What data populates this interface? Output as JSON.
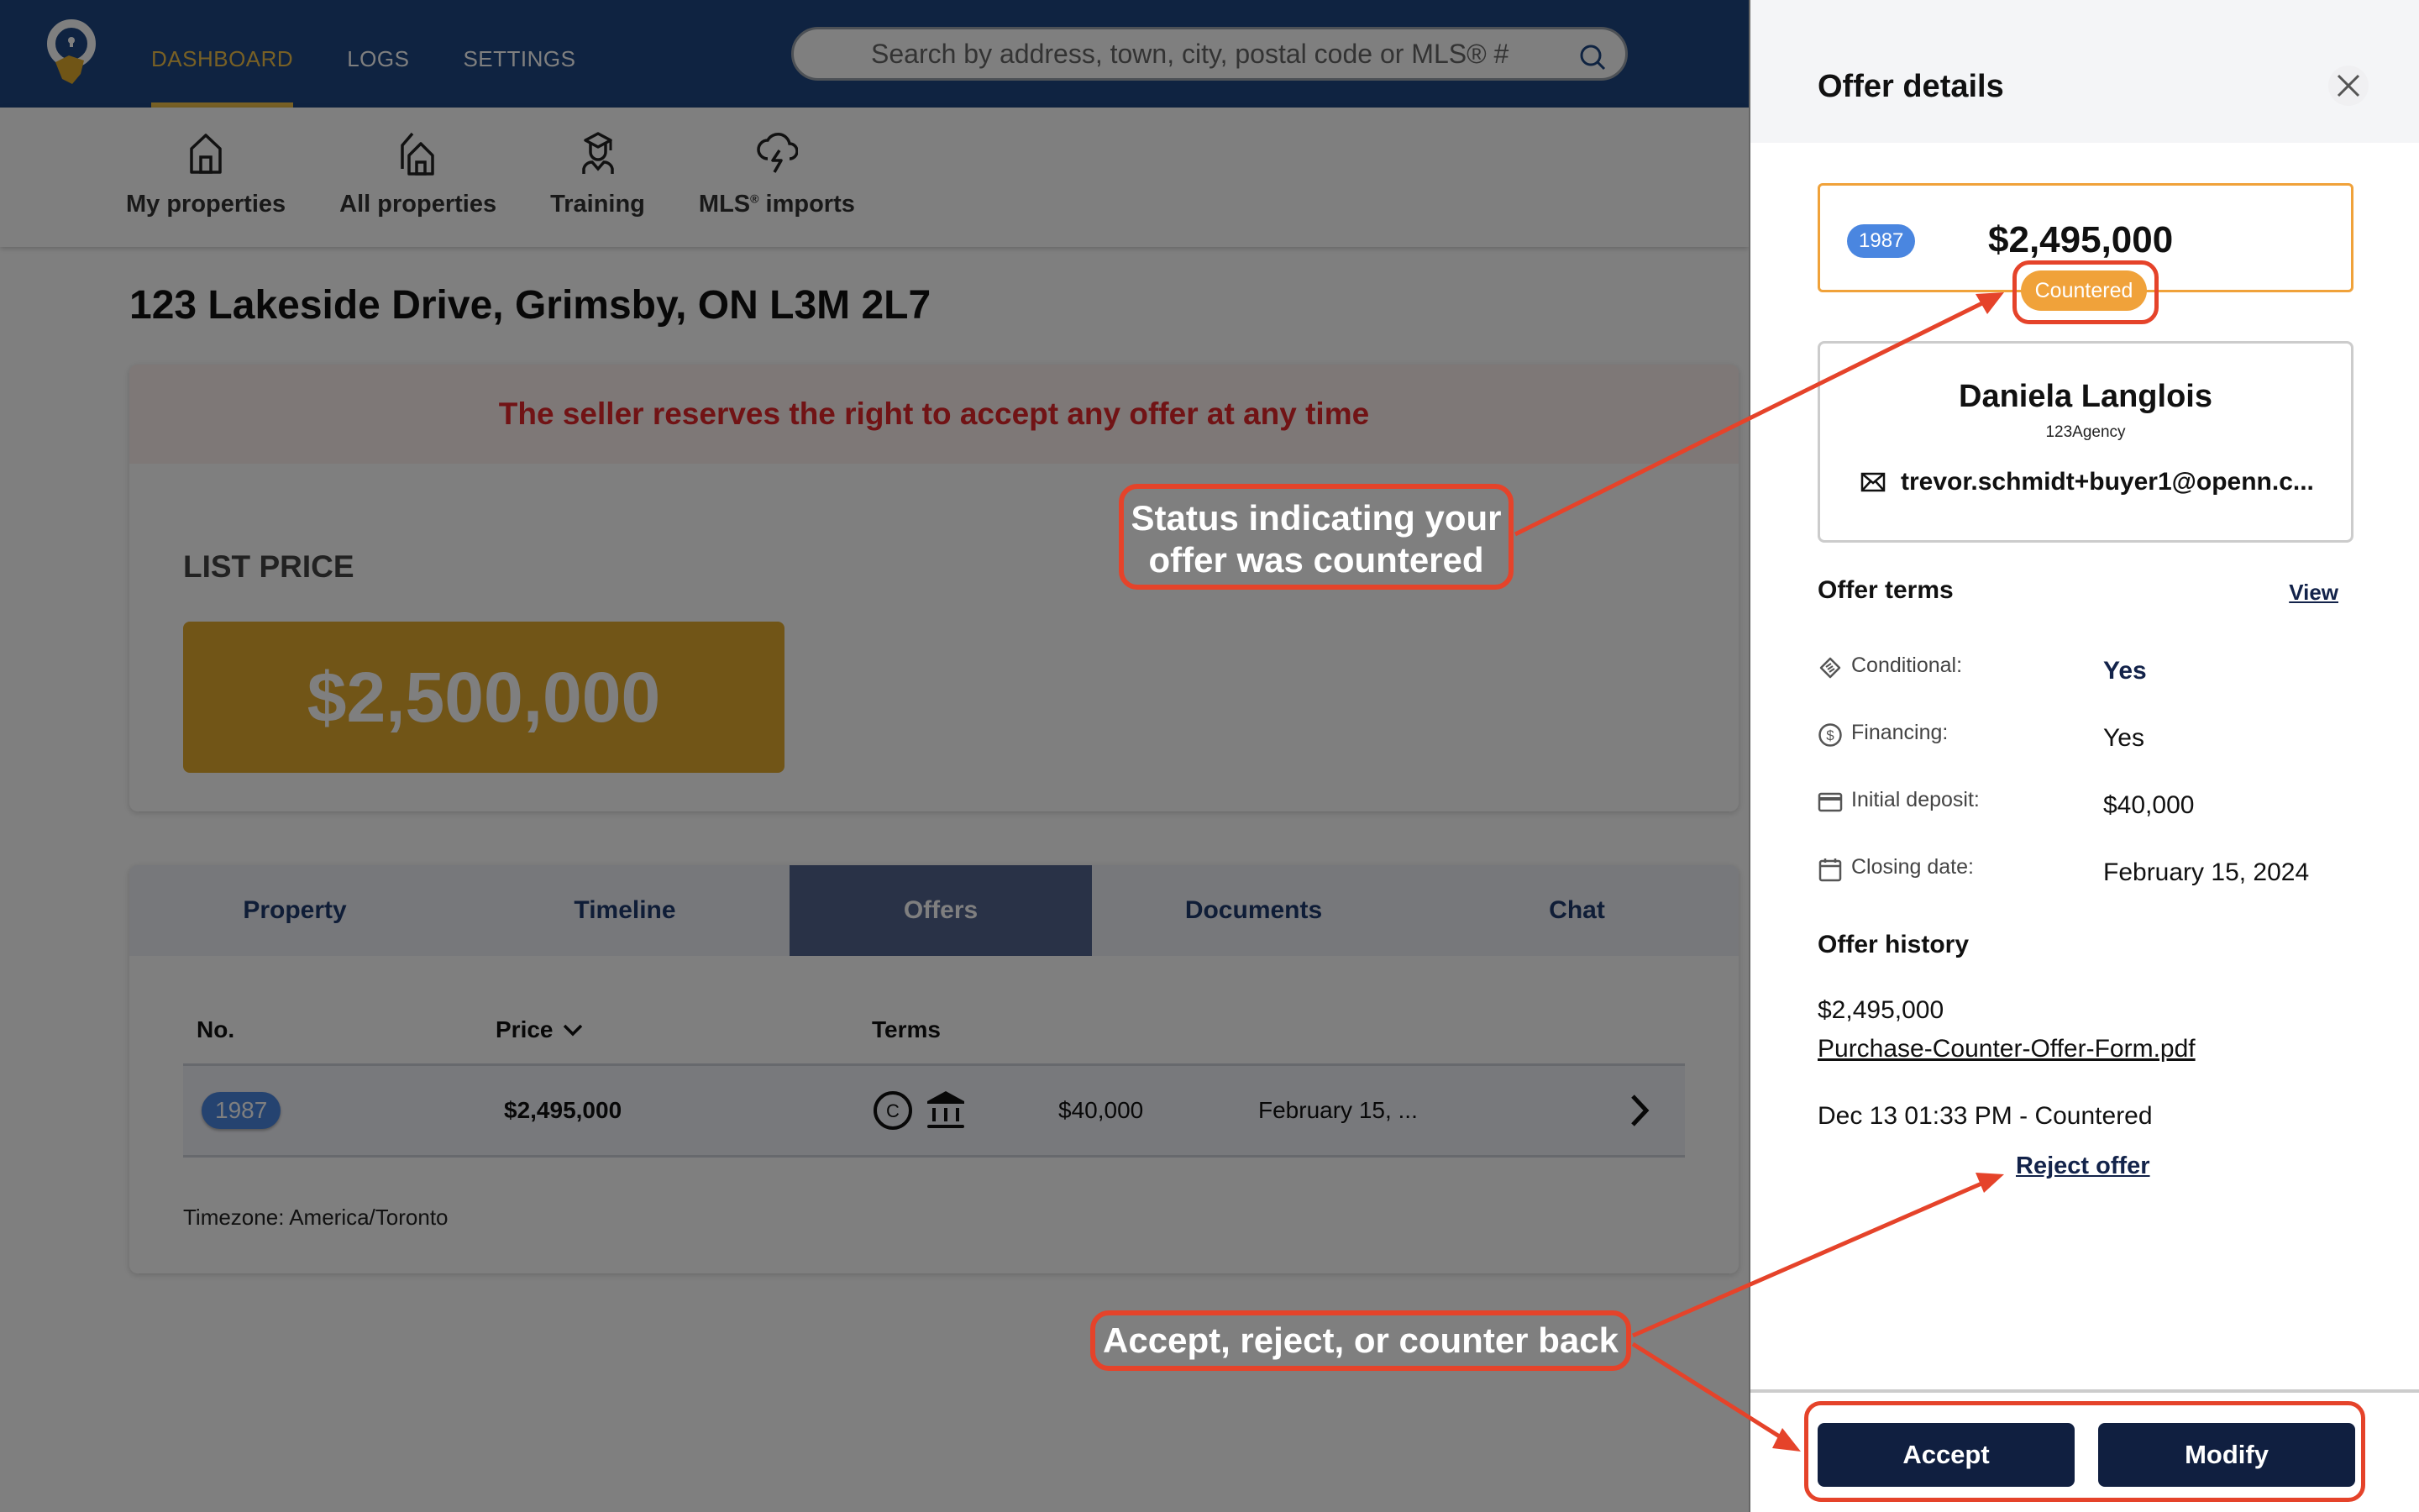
{
  "nav": {
    "links": [
      {
        "label": "DASHBOARD",
        "active": true
      },
      {
        "label": "LOGS",
        "active": false
      },
      {
        "label": "SETTINGS",
        "active": false
      }
    ],
    "search_placeholder": "Search by address, town, city, postal code or MLS® #"
  },
  "subnav": {
    "items": [
      {
        "label": "My properties",
        "icon": "house-icon"
      },
      {
        "label": "All properties",
        "icon": "houses-icon"
      },
      {
        "label": "Training",
        "icon": "graduate-icon"
      },
      {
        "label": "MLS",
        "sup": "®",
        "suffix": " imports",
        "icon": "cloud-lightning-icon"
      }
    ]
  },
  "property": {
    "address": "123 Lakeside Drive, Grimsby, ON L3M 2L7",
    "banner": "The seller reserves the right to accept any offer at any time",
    "list_price_label": "LIST PRICE",
    "list_price": "$2,500,000"
  },
  "tabs": [
    {
      "label": "Property",
      "active": false
    },
    {
      "label": "Timeline",
      "active": false
    },
    {
      "label": "Offers",
      "active": true
    },
    {
      "label": "Documents",
      "active": false
    },
    {
      "label": "Chat",
      "active": false
    }
  ],
  "offers_table": {
    "headers": {
      "no": "No.",
      "price": "Price",
      "terms": "Terms"
    },
    "rows": [
      {
        "no": "1987",
        "price": "$2,495,000",
        "deposit": "$40,000",
        "closing": "February 15, ..."
      }
    ],
    "timezone": "Timezone: America/Toronto"
  },
  "panel": {
    "title": "Offer details",
    "offer_no": "1987",
    "offer_price": "$2,495,000",
    "status": "Countered",
    "agent": {
      "name": "Daniela Langlois",
      "agency": "123Agency",
      "email": "trevor.schmidt+buyer1@openn.c..."
    },
    "terms_title": "Offer terms",
    "view_label": "View",
    "terms": [
      {
        "label": "Conditional:",
        "value": "Yes",
        "icon": "handshake-icon"
      },
      {
        "label": "Financing:",
        "value": "Yes",
        "icon": "dollar-circle-icon"
      },
      {
        "label": "Initial deposit:",
        "value": "$40,000",
        "icon": "credit-card-icon"
      },
      {
        "label": "Closing date:",
        "value": "February 15, 2024",
        "icon": "calendar-icon"
      }
    ],
    "history_title": "Offer history",
    "history": {
      "price": "$2,495,000",
      "file": "Purchase-Counter-Offer-Form.pdf",
      "event": "Dec 13 01:33 PM - Countered"
    },
    "reject_label": "Reject offer",
    "accept_label": "Accept",
    "modify_label": "Modify"
  },
  "annotations": {
    "status_callout": "Status indicating your offer was countered",
    "action_callout": "Accept, reject, or counter back",
    "color": "#e5432a"
  }
}
